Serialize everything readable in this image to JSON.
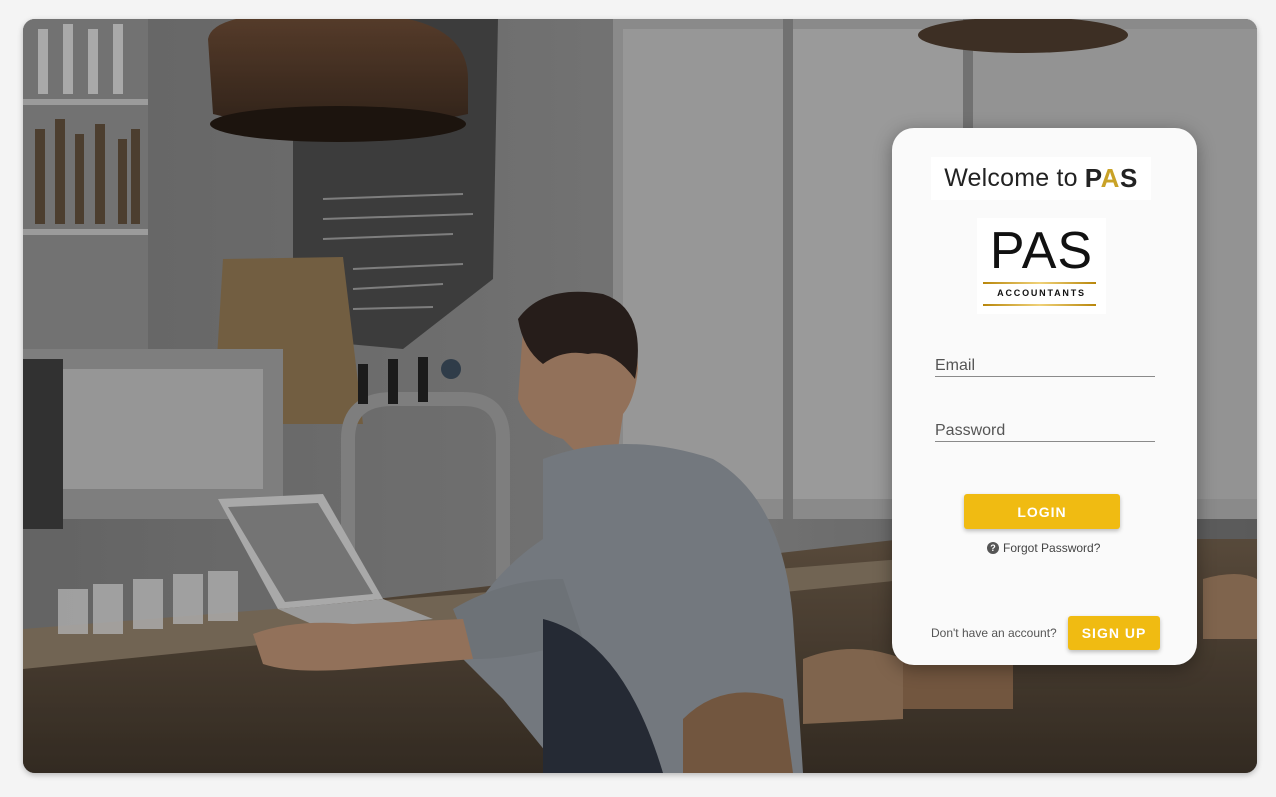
{
  "background": {
    "description_icon": "cafe-photo"
  },
  "card": {
    "welcome_prefix": "Welcome to",
    "welcome_brand_dark1": "P",
    "welcome_brand_gold": "A",
    "welcome_brand_dark2": "S",
    "logo_letters": "PAS",
    "logo_subtitle": "ACCOUNTANTS",
    "email_placeholder": "Email",
    "password_placeholder": "Password",
    "login_label": "LOGIN",
    "forgot_label": "Forgot Password?",
    "signup_prompt": "Don't have an account?",
    "signup_label": "SIGN UP"
  },
  "colors": {
    "accent": "#f0bb12",
    "card_bg": "#fafafa",
    "gold": "#c9a227"
  }
}
